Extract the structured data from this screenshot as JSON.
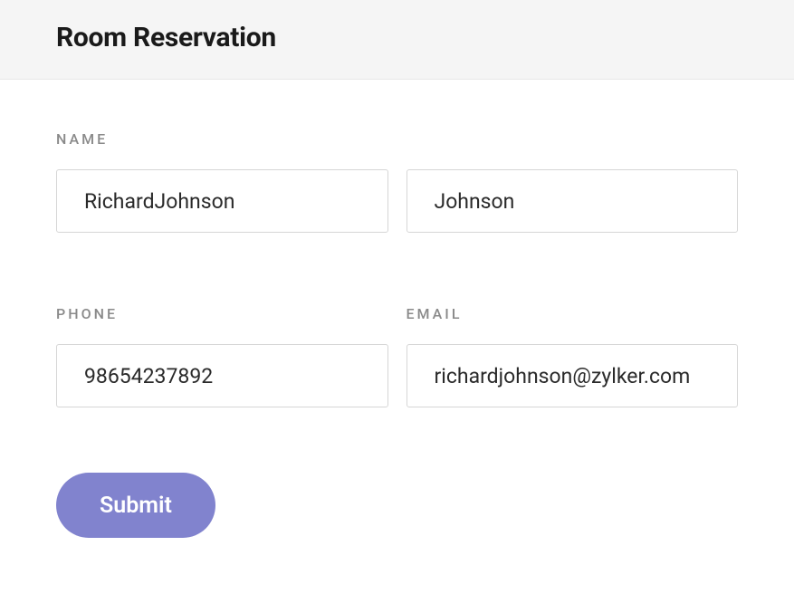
{
  "header": {
    "title": "Room Reservation"
  },
  "form": {
    "name_label": "NAME",
    "first_name_value": "RichardJohnson",
    "last_name_value": "Johnson",
    "phone_label": "PHONE",
    "phone_value": "98654237892",
    "email_label": "EMAIL",
    "email_value": "richardjohnson@zylker.com",
    "submit_label": "Submit"
  }
}
